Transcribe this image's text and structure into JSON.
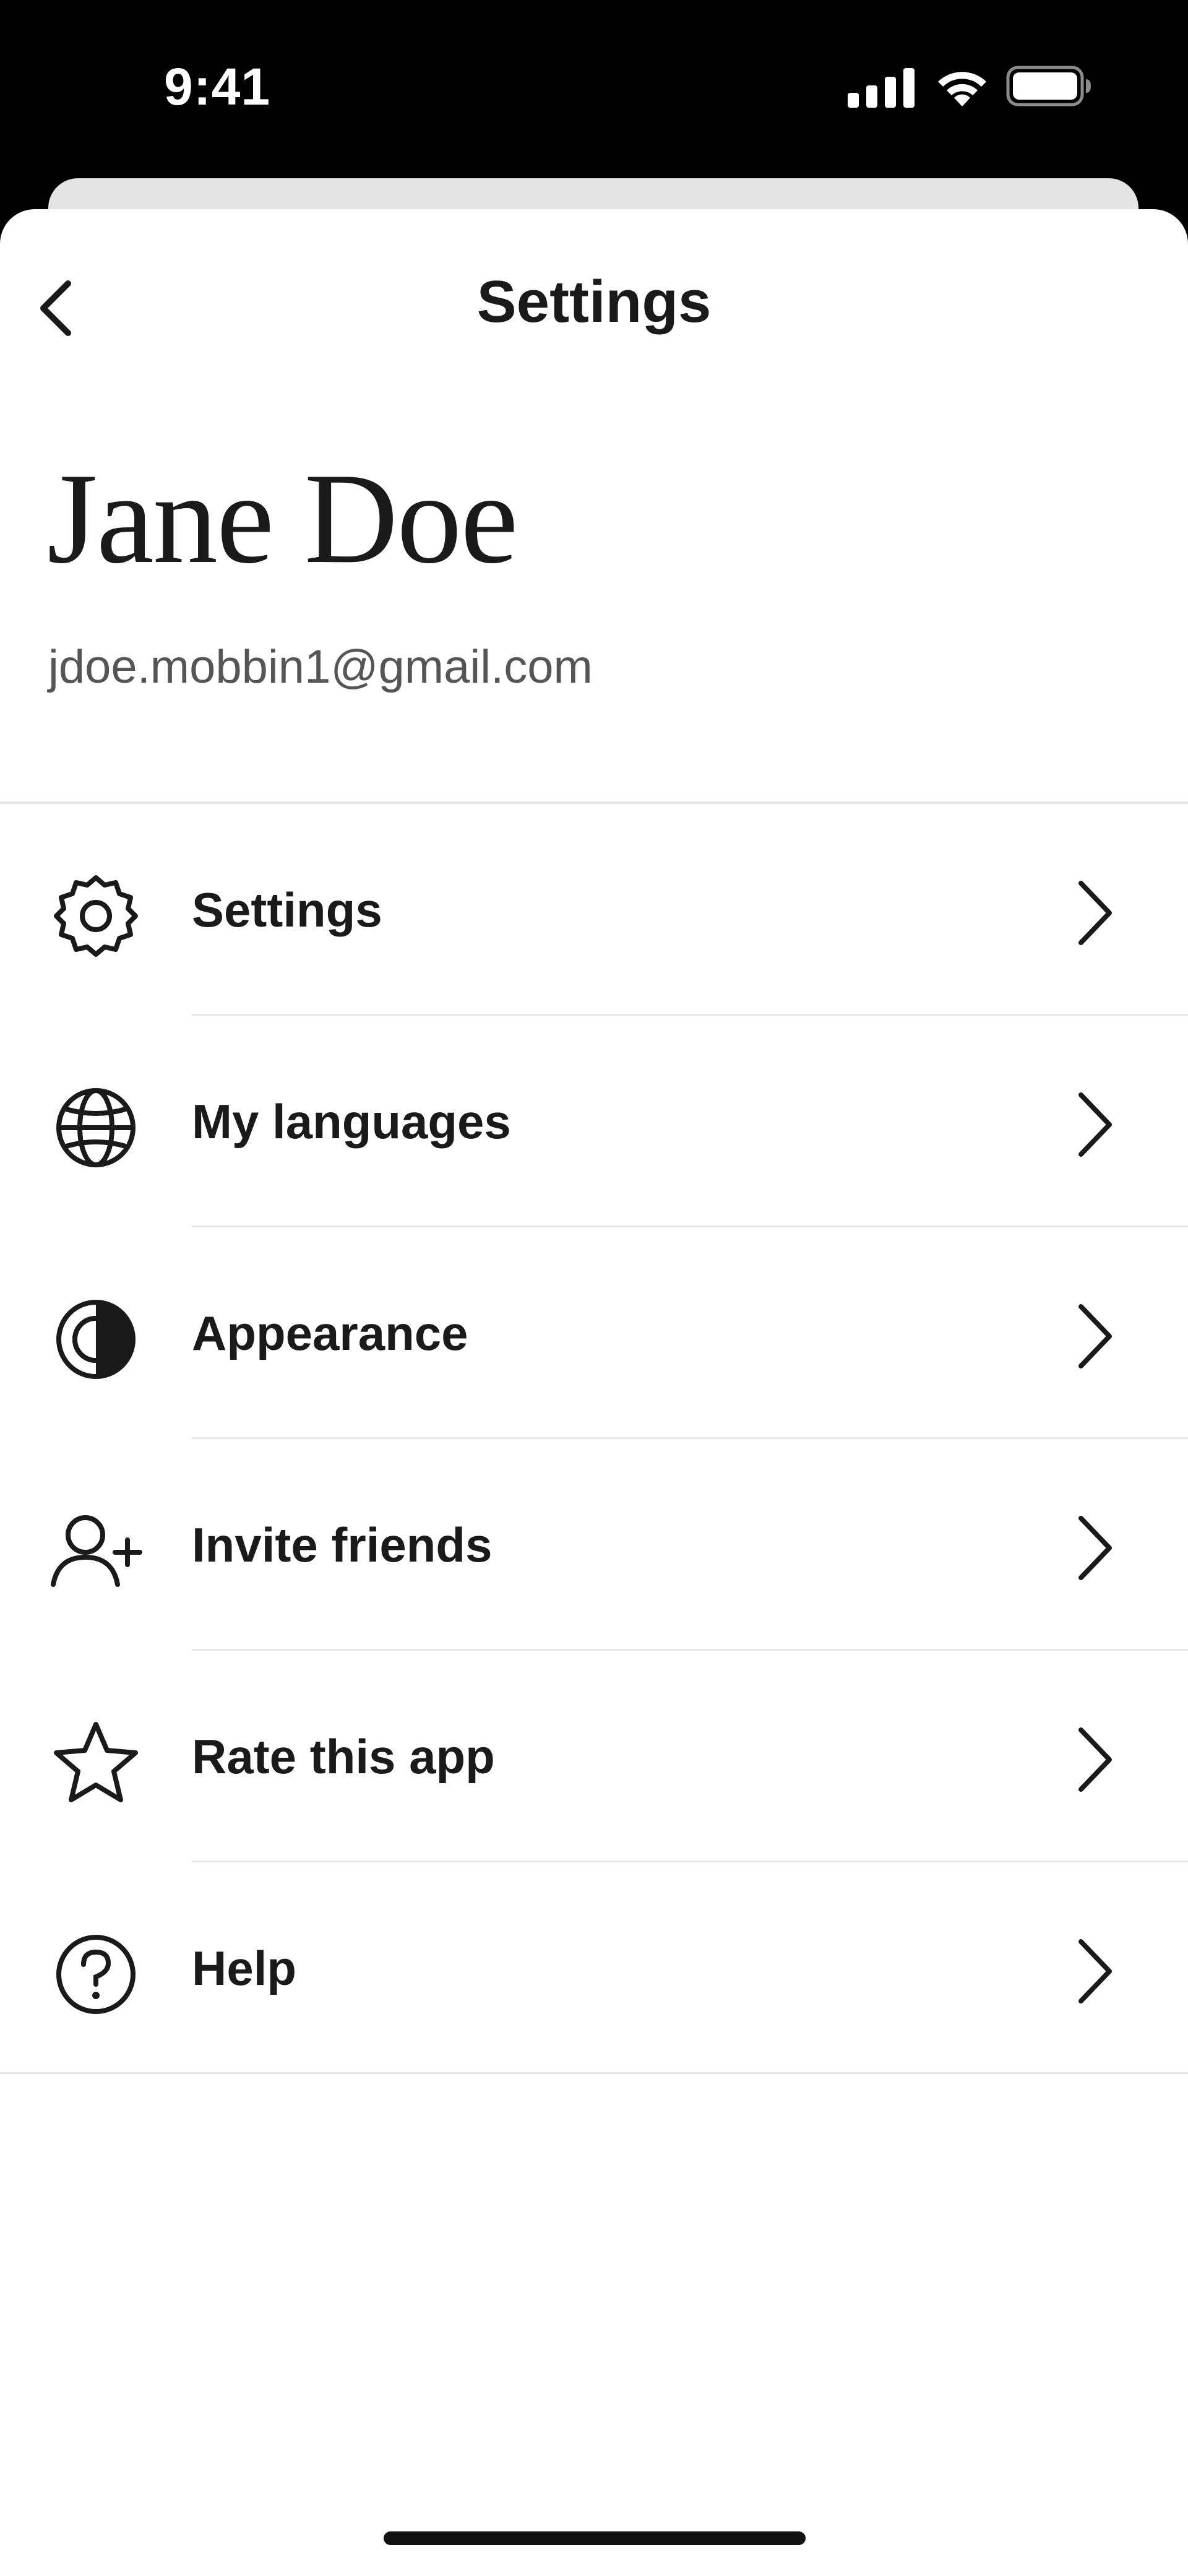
{
  "status_bar": {
    "time": "9:41",
    "icons": [
      "cellular-signal-icon",
      "wifi-icon",
      "battery-icon"
    ]
  },
  "header": {
    "title": "Settings",
    "back_icon": "chevron-left-icon"
  },
  "profile": {
    "name": "Jane Doe",
    "email": "jdoe.mobbin1@gmail.com"
  },
  "menu": {
    "items": [
      {
        "label": "Settings",
        "icon": "gear-icon"
      },
      {
        "label": "My languages",
        "icon": "globe-icon"
      },
      {
        "label": "Appearance",
        "icon": "half-circle-contrast-icon"
      },
      {
        "label": "Invite friends",
        "icon": "add-user-icon"
      },
      {
        "label": "Rate this app",
        "icon": "star-icon"
      },
      {
        "label": "Help",
        "icon": "question-circle-icon"
      }
    ],
    "chevron_icon": "chevron-right-icon"
  },
  "colors": {
    "background": "#ffffff",
    "status_bar": "#000000",
    "text": "#1a1a1a",
    "secondary_text": "#555555",
    "divider": "#e6e6e6",
    "back_sheet": "#e4e4e4"
  }
}
